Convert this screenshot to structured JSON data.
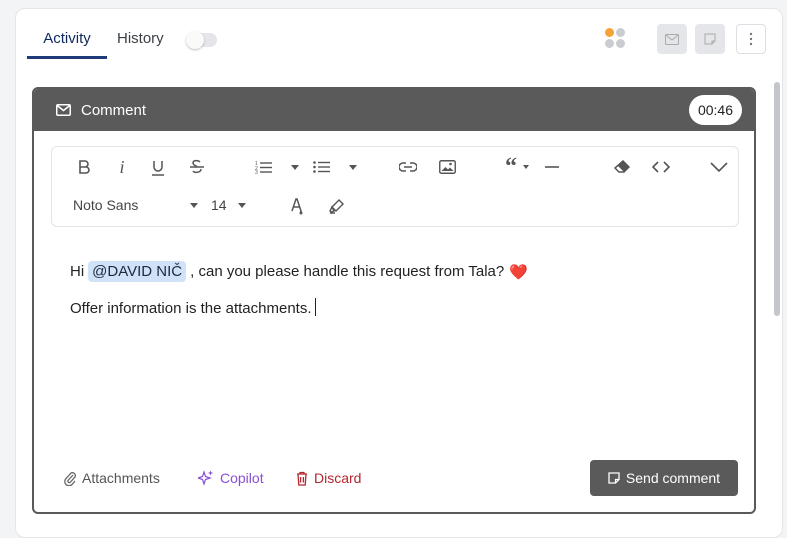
{
  "tabs": {
    "activity": "Activity",
    "history": "History"
  },
  "composer": {
    "title": "Comment",
    "timer": "00:46",
    "font": "Noto Sans",
    "font_size": "14",
    "line1_before": "Hi",
    "mention": "@DAVID NIČ",
    "line1_after": ", can you please handle this request from Tala?",
    "emoji": "❤️",
    "line2": "Offer information is the attachments."
  },
  "footer": {
    "attachments": "Attachments",
    "copilot": "Copilot",
    "discard": "Discard",
    "send": "Send comment"
  },
  "colors": {
    "header_bg": "#5a5a5a",
    "active_tab": "#1f3a7a",
    "mention_bg": "#cfe2f8",
    "copilot": "#8a4fd6",
    "discard": "#b3262d",
    "dot_orange": "#f5a238"
  },
  "icons": [
    "mail-icon",
    "bold-icon",
    "italic-icon",
    "underline-icon",
    "strikethrough-icon",
    "ordered-list-icon",
    "bullet-list-icon",
    "link-icon",
    "image-icon",
    "quote-icon",
    "horizontal-rule-icon",
    "eraser-icon",
    "code-icon",
    "chevron-down-icon",
    "text-color-icon",
    "highlighter-icon",
    "paperclip-icon",
    "sparkle-icon",
    "trash-icon",
    "note-icon"
  ]
}
